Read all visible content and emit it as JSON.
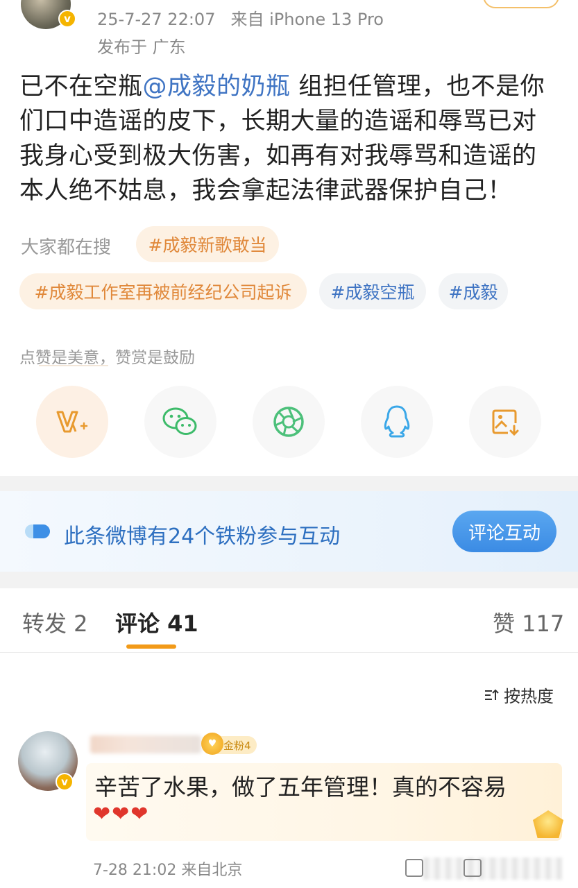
{
  "header": {
    "timestamp": "25-7-27 22:07",
    "source": "来自 iPhone 13 Pro",
    "location": "发布于 广东",
    "verified_mark": "v"
  },
  "post": {
    "text_before": "已不在空瓶",
    "mention": "@成毅的奶瓶",
    "text_after": " 组担任管理，也不是你们口中造谣的皮下，长期大量的造谣和辱骂已对我身心受到极大伤害，如再有对我辱骂和造谣的本人绝不姑息，我会拿起法律武器保护自己！"
  },
  "hot_search": {
    "label": "大家都在搜",
    "tags": [
      {
        "text": "#成毅新歌敢当",
        "style": "orange"
      },
      {
        "text": "#成毅工作室再被前经纪公司起诉",
        "style": "orange"
      },
      {
        "text": "#成毅空瓶",
        "style": "blue"
      },
      {
        "text": "#成毅",
        "style": "blue"
      }
    ]
  },
  "like_hint": "点赞是美意，赞赏是鼓励",
  "share_icons": [
    "vip-reward-icon",
    "wechat-icon",
    "moments-icon",
    "qq-icon",
    "save-image-icon"
  ],
  "fan_banner": {
    "text": "此条微博有24个铁粉参与互动",
    "button": "评论互动"
  },
  "tabs": {
    "repost": "转发 2",
    "comments": "评论 41",
    "likes": "赞 117"
  },
  "sort_label": "按热度",
  "comment": {
    "badge": "金粉4",
    "text": "辛苦了水果，做了五年管理！真的不容易",
    "hearts": "❤❤❤",
    "time": "7-28 21:02 来自北京"
  },
  "colors": {
    "accent_orange": "#f29a18",
    "link_blue": "#3f74c3",
    "tag_orange_bg": "#fdf1e3",
    "tag_blue_bg": "#f2f4f6"
  }
}
